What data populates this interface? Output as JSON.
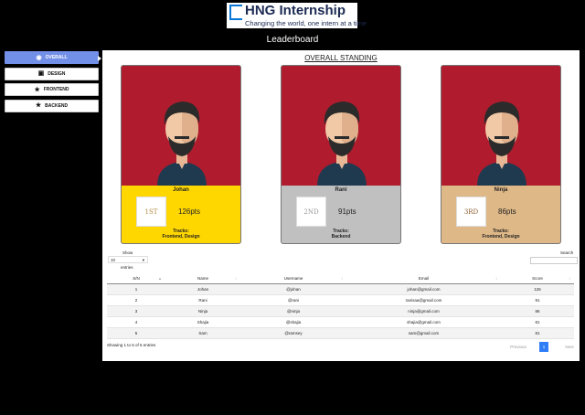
{
  "header": {
    "brand": "HNG Internship",
    "tagline": "Changing the world, one intern at a time",
    "page_title": "Leaderboard"
  },
  "sidebar": {
    "items": [
      {
        "label": "OVERALL",
        "icon": "user-circle-icon",
        "active": true
      },
      {
        "label": "DESIGN",
        "icon": "calendar-icon",
        "active": false
      },
      {
        "label": "FRONTEND",
        "icon": "star-icon",
        "active": false
      },
      {
        "label": "BACKEND",
        "icon": "star-icon",
        "active": false
      }
    ]
  },
  "standing_title": "OVERALL STANDING",
  "cards": [
    {
      "name": "Johan",
      "rank": "1ST",
      "points": "126",
      "unit": "pts",
      "tracks_label": "Tracks:",
      "tracks": "Frontend, Design",
      "color": "#ffd700"
    },
    {
      "name": "Rani",
      "rank": "2ND",
      "points": "91",
      "unit": "pts",
      "tracks_label": "Tracks:",
      "tracks": "Backend",
      "color": "#c0c0c0"
    },
    {
      "name": "Ninja",
      "rank": "3RD",
      "points": "86",
      "unit": "pts",
      "tracks_label": "Tracks:",
      "tracks": "Frontend, Design",
      "color": "#deb887"
    }
  ],
  "table": {
    "show_label": "Show",
    "entries_value": "10",
    "entries_label": "entries",
    "search_label": "Search",
    "columns": [
      "S/N",
      "Name",
      "Username",
      "Email",
      "Score"
    ],
    "rows": [
      [
        "1",
        "Johan",
        "@johan",
        "johan@gmail.com",
        "126"
      ],
      [
        "2",
        "Rani",
        "@rani",
        "ranisaa@gmail.com",
        "91"
      ],
      [
        "3",
        "Ninja",
        "@ninja",
        "ninja@gmail.com",
        "86"
      ],
      [
        "4",
        "Shajia",
        "@shajia",
        "shajia@gmail.com",
        "81"
      ],
      [
        "5",
        "Sam",
        "@ramsey",
        "sam@gmail.com",
        "81"
      ]
    ],
    "info": "Showing 1 to 5 of 5 entries",
    "pagination": {
      "previous": "Previous",
      "current": "1",
      "next": "Next"
    }
  },
  "colors": {
    "accent": "#7390e8",
    "card_red": "#b01c2e",
    "page_blue": "#2f7df6"
  }
}
